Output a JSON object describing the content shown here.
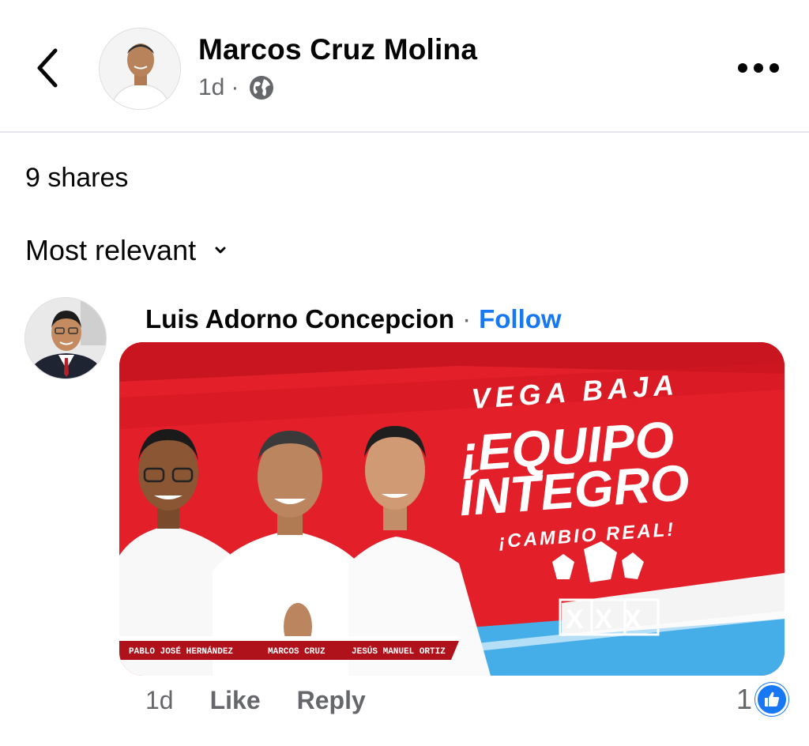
{
  "post": {
    "author_name": "Marcos Cruz Molina",
    "time": "1d",
    "separator": "·",
    "privacy_icon": "globe-icon"
  },
  "shares_text": "9 shares",
  "sort_label": "Most relevant",
  "comment": {
    "author_name": "Luis Adorno Concepcion",
    "separator": "·",
    "follow_label": "Follow",
    "time": "1d",
    "like_label": "Like",
    "reply_label": "Reply",
    "reaction_count": "1",
    "image": {
      "line1": "VEGA BAJA",
      "line2": "¡EQUIPO",
      "line3": "ÍNTEGRO",
      "line4": "¡CAMBIO REAL!",
      "name1": "PABLO JOSÉ HERNÁNDEZ",
      "name2": "MARCOS CRUZ",
      "name3": "JESÚS MANUEL ORTIZ",
      "ballot": "XXX"
    }
  },
  "colors": {
    "accent": "#1877f2",
    "banner_red": "#e3202a",
    "banner_blue": "#45aee8"
  }
}
